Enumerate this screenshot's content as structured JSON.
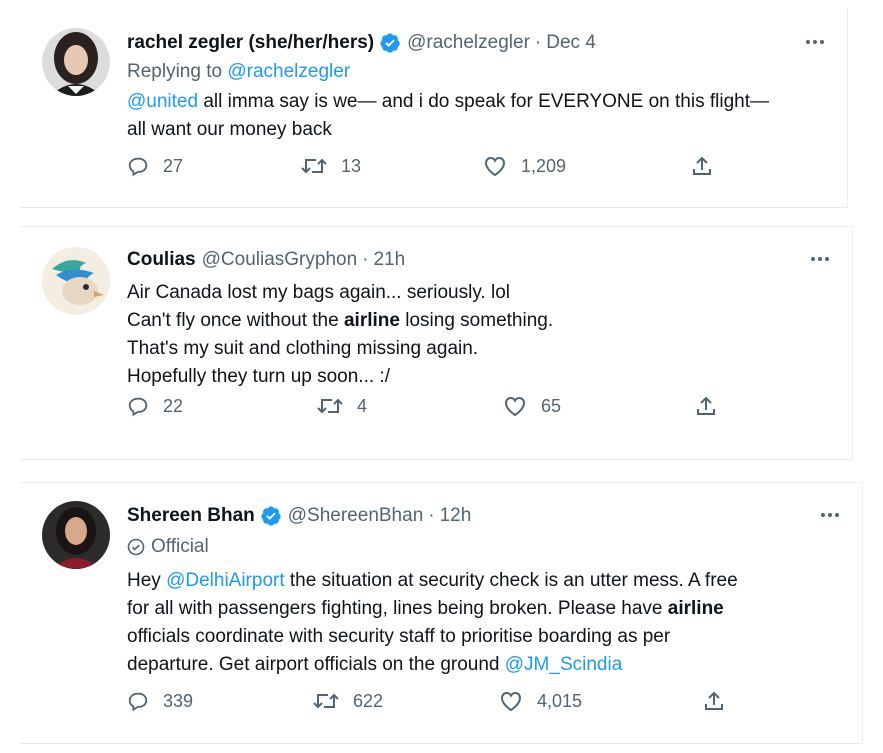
{
  "tweets": [
    {
      "name": "rachel zegler (she/her/hers)",
      "verified": true,
      "handle": "@rachelzegler",
      "separator": "·",
      "time": "Dec 4",
      "replying_prefix": "Replying to",
      "replying_to": "@rachelzegler",
      "text": {
        "mention": "@united",
        "line1_rest": " all imma say is we— and i do speak for EVERYONE on this flight—",
        "line2": "all want our money back"
      },
      "replies": "27",
      "retweets": "13",
      "likes": "1,209"
    },
    {
      "name": "Coulias",
      "verified": false,
      "handle": "@CouliasGryphon",
      "separator": "·",
      "time": "21h",
      "text": {
        "line1": "Air Canada lost my bags again... seriously. lol",
        "line2_pre": "Can't fly once without the ",
        "line2_bold": "airline",
        "line2_post": " losing something.",
        "line3": "That's my suit and clothing missing again.",
        "line4": "Hopefully they turn up soon... :/"
      },
      "replies": "22",
      "retweets": "4",
      "likes": "65"
    },
    {
      "name": "Shereen Bhan",
      "verified": true,
      "handle": "@ShereenBhan",
      "separator": "·",
      "time": "12h",
      "official_label": "Official",
      "text": {
        "l1_pre": "Hey ",
        "l1_mention": "@DelhiAirport",
        "l1_post": " the situation at security check is an utter mess. A free",
        "l2_pre": "for all with passengers fighting, lines being broken. Please have ",
        "l2_bold": "airline",
        "l3": "officials coordinate with security staff to prioritise boarding as per",
        "l4_pre": "departure. Get airport officials on the ground ",
        "l4_mention": "@JM_Scindia"
      },
      "replies": "339",
      "retweets": "622",
      "likes": "4,015"
    }
  ],
  "colors": {
    "link": "#1d9bf0",
    "secondary": "#536471",
    "primary_text": "#0f1419",
    "verified_badge": "#1d9bf0"
  },
  "icons": {
    "verified": "verified-badge-icon",
    "more": "more-icon",
    "reply": "reply-icon",
    "retweet": "retweet-icon",
    "like": "like-icon",
    "share": "share-icon",
    "official": "official-badge-icon"
  }
}
